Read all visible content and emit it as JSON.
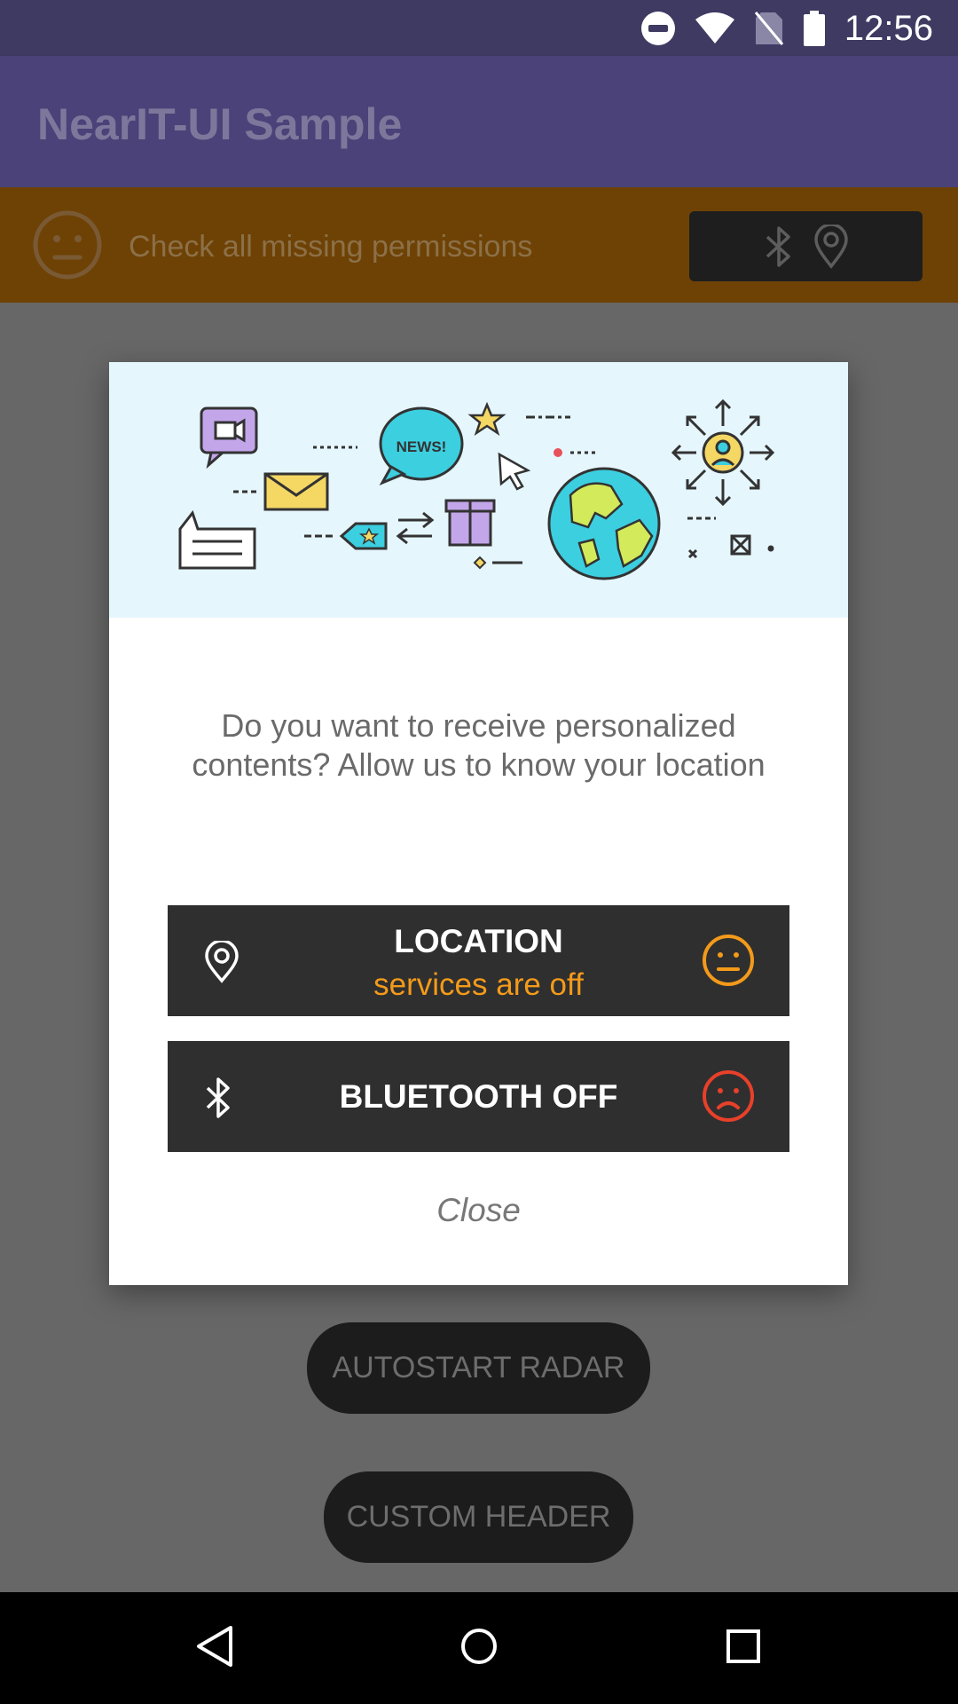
{
  "status_bar": {
    "time": "12:56",
    "icons": [
      "do-not-disturb-icon",
      "wifi-icon",
      "no-sim-icon",
      "battery-icon"
    ]
  },
  "app_bar": {
    "title": "NearIT-UI Sample"
  },
  "permission_bar": {
    "message": "Check all missing permissions",
    "face_icon": "neutral-face-icon",
    "button_icons": [
      "bluetooth-icon",
      "location-pin-icon"
    ]
  },
  "background_buttons": {
    "autostart_radar": "AUTOSTART RADAR",
    "custom_header": "CUSTOM HEADER"
  },
  "dialog": {
    "hero_badge": "NEWS!",
    "message": "Do you want to receive personalized contents? Allow us to know your location",
    "location": {
      "title": "LOCATION",
      "subtitle": "services are off",
      "icon": "location-pin-icon",
      "status_icon": "neutral-face-icon",
      "status_color": "#f39a1a"
    },
    "bluetooth": {
      "title": "BLUETOOTH OFF",
      "icon": "bluetooth-icon",
      "status_icon": "sad-face-icon",
      "status_color": "#e8402a"
    },
    "close_label": "Close"
  },
  "nav_bar": {
    "buttons": [
      "back-icon",
      "home-icon",
      "recents-icon"
    ]
  },
  "colors": {
    "primary": "#4a4278",
    "status_bar": "#3f3a62",
    "permission_bar": "#6e4205",
    "row_bg": "#2f2f2f"
  }
}
